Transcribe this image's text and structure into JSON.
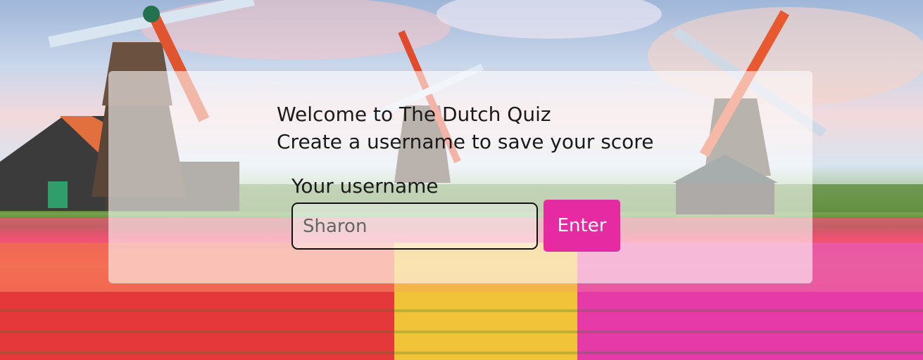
{
  "welcome": {
    "line1": "Welcome to The Dutch Quiz",
    "line2": "Create a username to save your score"
  },
  "form": {
    "label": "Your username",
    "username_value": "Sharon",
    "enter_label": "Enter"
  },
  "colors": {
    "accent": "#e62aa2",
    "panel": "rgba(255,255,255,0.58)"
  },
  "background": {
    "scene": "windmills-and-tulip-field"
  }
}
